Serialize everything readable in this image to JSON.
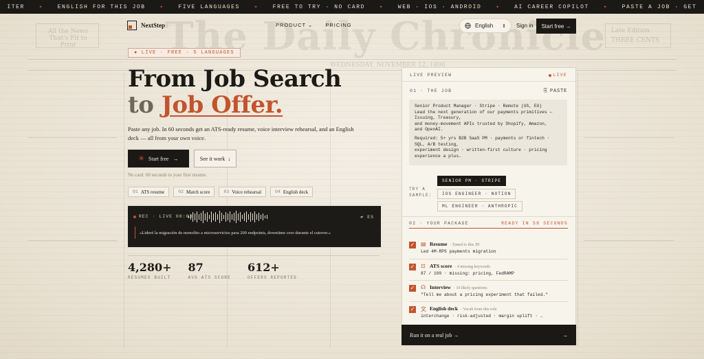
{
  "ticker": [
    "ITER",
    "ENGLISH FOR THIS JOB",
    "FIVE LANGUAGES",
    "FREE TO TRY · NO CARD",
    "WEB · IOS · ANDROID",
    "AI CAREER COPILOT",
    "PASTE A JOB · GET"
  ],
  "nav": {
    "brand": "NextStep",
    "brand_dot": "·",
    "links": [
      "PRODUCT",
      "PRICING"
    ],
    "language": "English",
    "signin": "Sign in",
    "start_free": "Start free →"
  },
  "background": {
    "masthead": "The Daily Chronicle",
    "date_line": "WEDNESDAY, NOVEMBER 12, 1890",
    "left_box": "All the News That's Fit to Print",
    "right_box": "Late Edition",
    "right_box_2": "THREE CENTS"
  },
  "hero": {
    "badge": "● LIVE · FREE · 5 LANGUAGES",
    "title_line1": "From Job Search",
    "title_to": "to",
    "title_accent": "Job Offer.",
    "subtitle": "Paste any job. In 60 seconds get an ATS-ready resume, voice interview rehearsal, and an English deck — all from your own voice.",
    "btn_primary": "Start free",
    "btn_primary_arrow": "→",
    "btn_secondary": "See it work",
    "btn_secondary_arrow": "↓",
    "no_card": "No card. 60 seconds to your first resume.",
    "chips": [
      {
        "n": "01",
        "label": "ATS resume"
      },
      {
        "n": "02",
        "label": "Match score"
      },
      {
        "n": "03",
        "label": "Voice rehearsal"
      },
      {
        "n": "04",
        "label": "English deck"
      }
    ]
  },
  "recorder": {
    "status": "REC · LIVE 00:03",
    "lang": "ES",
    "quote": "«Lideré la migración de monolito a microservicios para 200 endpoints, downtime cero durante el cutover.»"
  },
  "stats": [
    {
      "value": "4,280",
      "plus": "+",
      "label": "RESUMES BUILT"
    },
    {
      "value": "87",
      "plus": "",
      "label": "AVG ATS SCORE"
    },
    {
      "value": "612",
      "plus": "+",
      "label": "OFFERS REPORTED"
    }
  ],
  "card": {
    "live_preview": "LIVE PREVIEW",
    "live": "LIVE",
    "job_header": "01 · THE JOB",
    "paste": "PASTE",
    "jd_lines": [
      "Senior Product Manager · Stripe · Remote (US, EU)",
      "Lead the next generation of our payments primitives —",
      "Issuing, Treasury,",
      "and money-movement APIs trusted by Shopify, Amazon,",
      "and OpenAI.",
      "Required: 5+ yrs B2B SaaS PM · payments or fintech ·",
      "SQL, A/B testing,",
      "experiment design · written-first culture · pricing",
      "experience a plus."
    ],
    "try_label": "TRY A SAMPLE:",
    "samples": [
      "SENIOR PM · STRIPE",
      "IOS ENGINEER · NOTION",
      "ML ENGINEER · ANTHROPIC"
    ],
    "package": "02 · YOUR PACKAGE",
    "ready": "READY IN 58 SECONDS",
    "items": [
      {
        "title": "Resume",
        "sub": "· Tuned to this JD",
        "detail": "Led 4M-RPS payments migration"
      },
      {
        "title": "ATS score",
        "sub": "· 4 missing keywords",
        "detail": "87 / 100 · missing: pricing, FedRAMP"
      },
      {
        "title": "Interview",
        "sub": "· 10 likely questions",
        "detail": "\"Tell me about a pricing experiment that failed.\""
      },
      {
        "title": "English deck",
        "sub": "· Vocab from this role",
        "detail": "interchange · risk-adjusted · margin uplift · …"
      }
    ],
    "run": "Run it on a real job →",
    "run_arrow": "→"
  },
  "colors": {
    "accent": "#c2542d",
    "ink": "#1b1916",
    "paper": "#ece6d9"
  }
}
